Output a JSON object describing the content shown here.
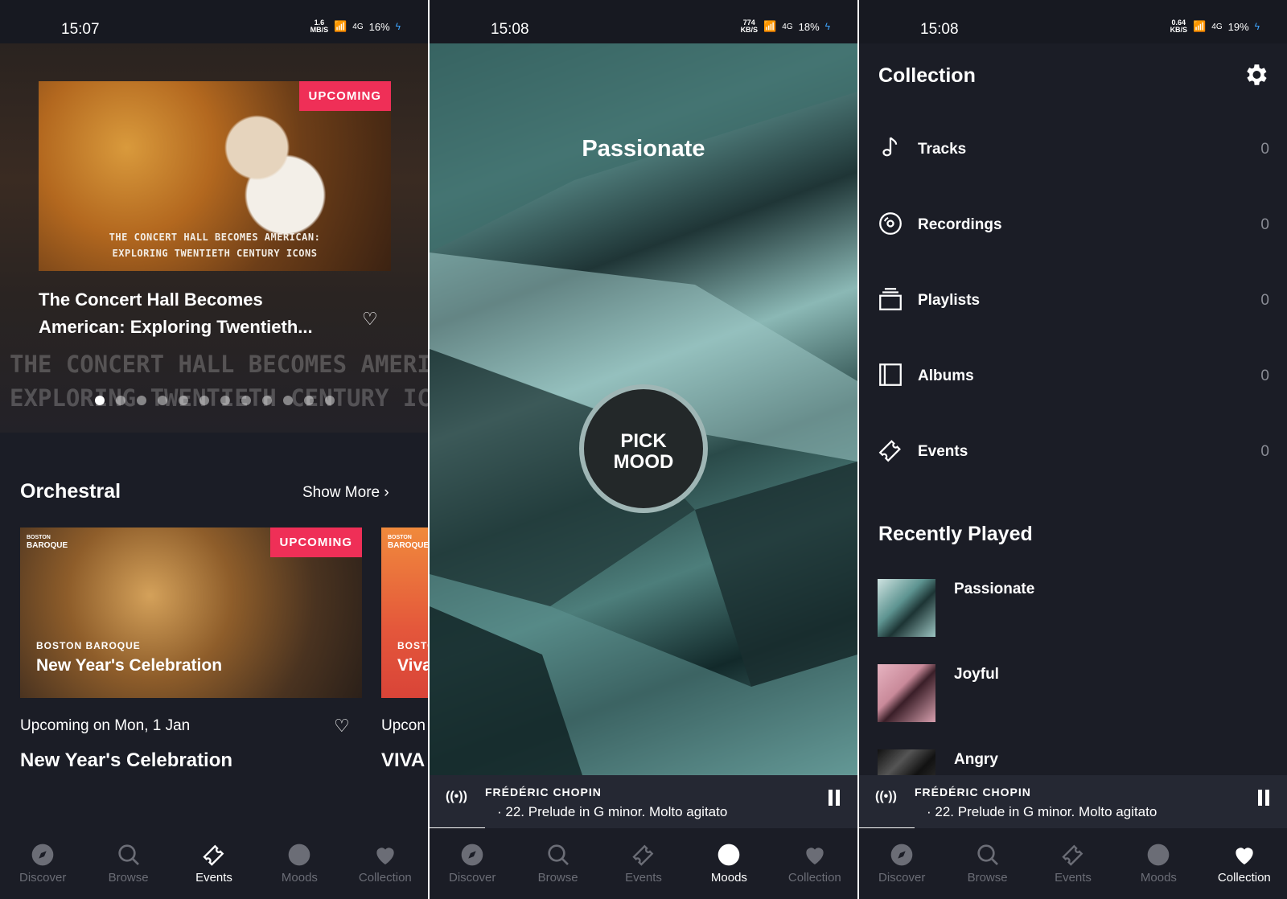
{
  "screens": [
    {
      "status": {
        "time": "15:07",
        "speed_value": "1.6",
        "speed_unit": "MB/S",
        "network": "4G",
        "battery": "16%"
      },
      "hero": {
        "badge": "UPCOMING",
        "image_caption_line1": "THE CONCERT HALL BECOMES AMERICAN:",
        "image_caption_line2": "EXPLORING TWENTIETH CENTURY ICONS",
        "title": "The Concert Hall Becomes American: Exploring Twentieth...",
        "big_line1": "THE CONCERT HALL BECOMES AMERICAN:",
        "big_line2": "EXPLORING TWENTIETH CENTURY ICONS",
        "dot_count": 12,
        "active_dot": 0
      },
      "section": {
        "title": "Orchestral",
        "show_more": "Show More"
      },
      "cards": [
        {
          "logo_top": "BOSTON",
          "logo_bottom": "BAROQUE",
          "badge": "UPCOMING",
          "org": "BOSTON BAROQUE",
          "title": "New Year's Celebration",
          "date": "Upcoming on Mon, 1 Jan",
          "event_title": "New Year's Celebration"
        },
        {
          "logo_top": "BOSTON",
          "logo_bottom": "BAROQUE",
          "org": "BOSTO",
          "title": "Viva",
          "date": "Upcon",
          "event_title": "VIVA"
        }
      ],
      "nav_active": "Events"
    },
    {
      "status": {
        "time": "15:08",
        "speed_value": "774",
        "speed_unit": "KB/S",
        "network": "4G",
        "battery": "18%"
      },
      "mood_title": "Passionate",
      "pick_line1": "PICK",
      "pick_line2": "MOOD",
      "nav_active": "Moods"
    },
    {
      "status": {
        "time": "15:08",
        "speed_value": "0.64",
        "speed_unit": "KB/S",
        "network": "4G",
        "battery": "19%"
      },
      "title": "Collection",
      "items": [
        {
          "label": "Tracks",
          "count": "0",
          "icon": "music-note-icon"
        },
        {
          "label": "Recordings",
          "count": "0",
          "icon": "disc-icon"
        },
        {
          "label": "Playlists",
          "count": "0",
          "icon": "playlist-icon"
        },
        {
          "label": "Albums",
          "count": "0",
          "icon": "album-icon"
        },
        {
          "label": "Events",
          "count": "0",
          "icon": "ticket-icon"
        }
      ],
      "recently_played_title": "Recently Played",
      "recently_played": [
        {
          "label": "Passionate",
          "color": "#7fb3b0"
        },
        {
          "label": "Joyful",
          "color": "#c98a9a"
        },
        {
          "label": "Angry",
          "color": "#2a2a2a"
        }
      ],
      "nav_active": "Collection"
    }
  ],
  "player": {
    "artist": "FRÉDÉRIC CHOPIN",
    "track": "· 22. Prelude in G minor. Molto agitato",
    "radio_icon": "radio-icon",
    "progress": 0.13
  },
  "nav": {
    "items": [
      {
        "label": "Discover",
        "icon": "compass-icon"
      },
      {
        "label": "Browse",
        "icon": "search-icon"
      },
      {
        "label": "Events",
        "icon": "ticket-icon"
      },
      {
        "label": "Moods",
        "icon": "moon-icon"
      },
      {
        "label": "Collection",
        "icon": "heart-icon"
      }
    ]
  },
  "colors": {
    "badge": "#ef2f57",
    "background": "#1b1d26",
    "nav_inactive": "#6b6d76",
    "accent_bolt": "#3fa5ff"
  }
}
